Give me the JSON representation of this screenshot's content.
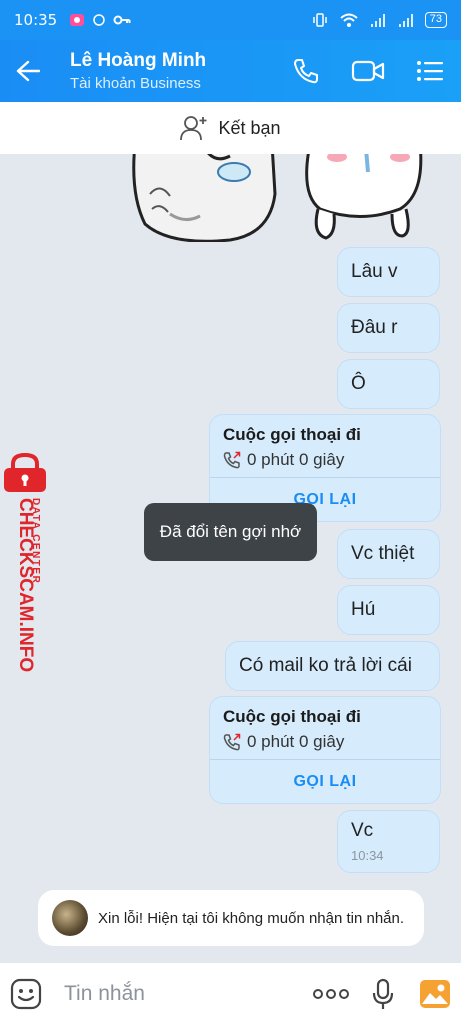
{
  "status_bar": {
    "time": "10:35",
    "battery": "73"
  },
  "header": {
    "name": "Lê Hoàng Minh",
    "subtitle": "Tài khoản Business"
  },
  "add_friend": {
    "label": "Kết bạn"
  },
  "messages": [
    {
      "text": "Lâu v"
    },
    {
      "text": "Đâu r"
    },
    {
      "text": "Ô"
    },
    {
      "text": "Vc thiệt"
    },
    {
      "text": "Hú"
    },
    {
      "text": "Có mail ko trả lời cái"
    },
    {
      "text": "Vc",
      "time": "10:34"
    }
  ],
  "calls": [
    {
      "title": "Cuộc gọi thoại đi",
      "duration": "0 phút 0 giây",
      "action": "GỌI LẠI"
    },
    {
      "title": "Cuộc gọi thoại đi",
      "duration": "0 phút 0 giây",
      "action": "GỌI LẠI"
    }
  ],
  "toast": {
    "text": "Đã đổi tên gợi nhớ"
  },
  "watermark": {
    "main": "CHECKSCAM.INFO",
    "small": "DATA CENTER"
  },
  "system_message": {
    "text": "Xin lỗi! Hiện tại tôi không muốn nhận tin nhắn."
  },
  "input": {
    "placeholder": "Tin nhắn"
  },
  "colors": {
    "header": "#1a8df5",
    "bubble": "#d6ecfd",
    "accent": "#1a8df5",
    "watermark": "#e0252b"
  }
}
